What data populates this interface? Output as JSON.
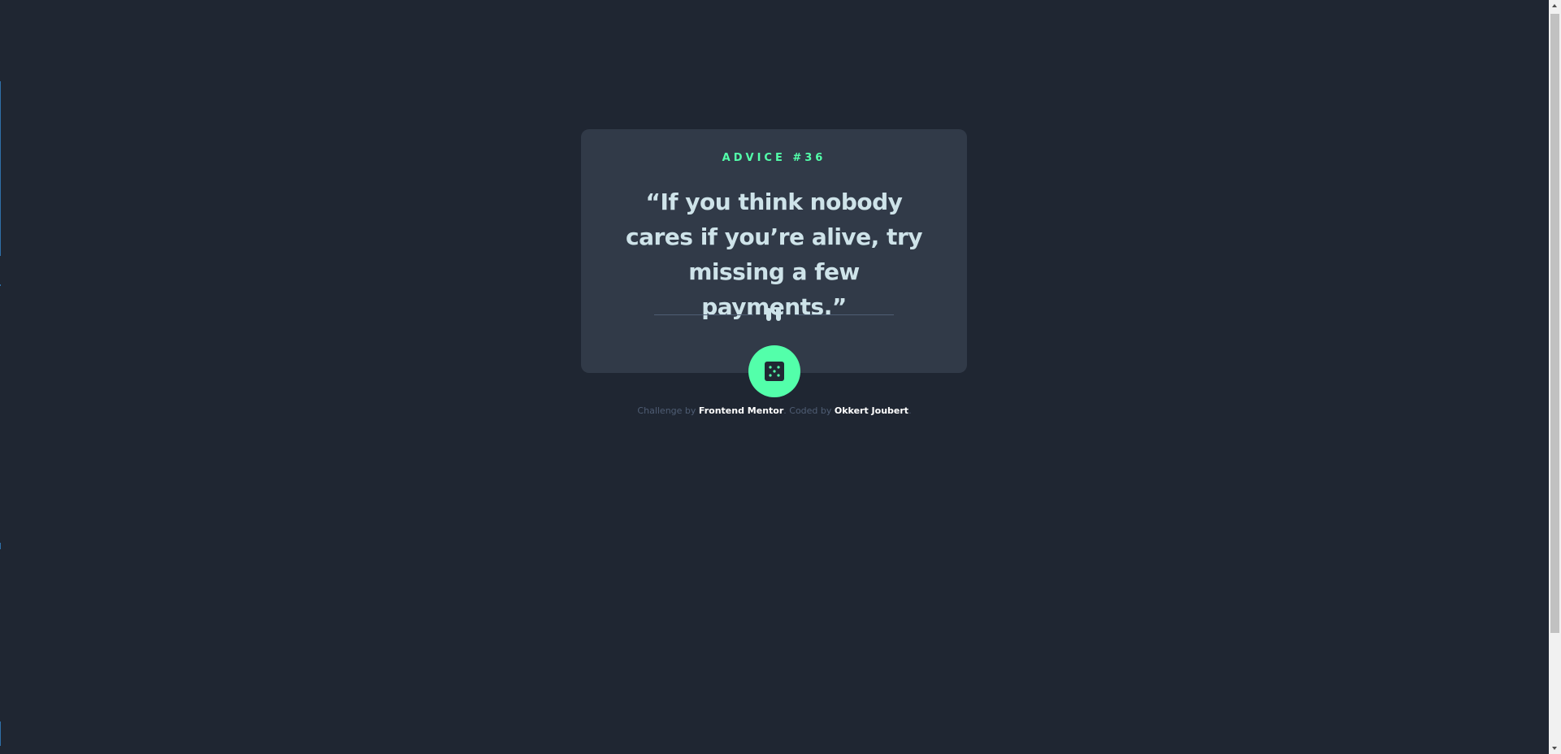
{
  "card": {
    "advice_label": "ADVICE #36",
    "quote": "“If you think nobody cares if you’re alive, try missing a few payments.”"
  },
  "dice_button": {
    "icon": "dice-icon",
    "aria_label": "Generate new advice"
  },
  "attribution": {
    "prefix": "Challenge by ",
    "challenge_link": "Frontend Mentor",
    "middle": ". Coded by ",
    "author_link": "Okkert Joubert",
    "suffix": "."
  },
  "colors": {
    "background": "#1f2632",
    "card": "#313a48",
    "accent": "#53ffaa",
    "text": "#cee3e9",
    "muted": "#4f5d74"
  }
}
